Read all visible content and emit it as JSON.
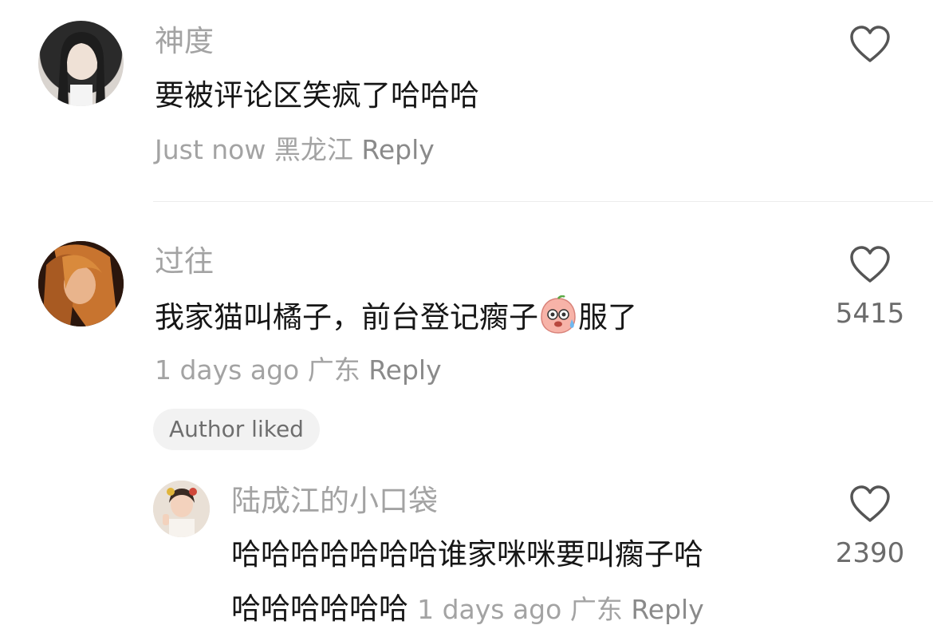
{
  "comments": [
    {
      "username": "神度",
      "text": "要被评论区笑疯了哈哈哈",
      "time": "Just now",
      "location": "黑龙江",
      "reply_label": "Reply",
      "likes": ""
    },
    {
      "username": "过往",
      "text_before_emoji": "我家猫叫橘子，前台登记瘸子",
      "text_after_emoji": "服了",
      "time": "1 days ago",
      "location": "广东",
      "reply_label": "Reply",
      "likes": "5415",
      "badge": "Author liked",
      "replies": [
        {
          "username": "陆成江的小口袋",
          "text_line1": "哈哈哈哈哈哈哈谁家咪咪要叫瘸子哈",
          "text_line2": "哈哈哈哈哈哈",
          "time": "1 days ago",
          "location": "广东",
          "reply_label": "Reply",
          "likes": "2390"
        }
      ]
    }
  ],
  "icons": {
    "like": "heart-outline-icon",
    "emoji": "sweating-face-emoji"
  },
  "colors": {
    "username": "#a3a3a3",
    "text": "#161616",
    "meta": "#a3a3a3",
    "icon": "#555555",
    "badge_bg": "#f2f2f2"
  }
}
